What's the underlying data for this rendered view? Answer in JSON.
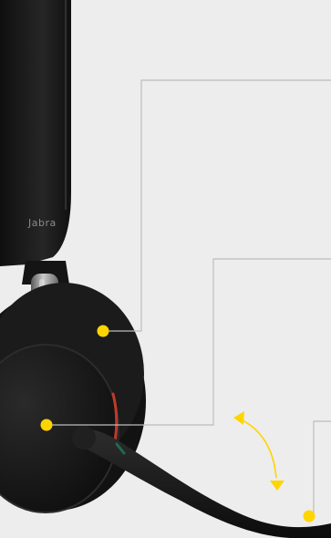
{
  "product": {
    "brand_mark": "Jabra"
  },
  "colors": {
    "background": "#ededed",
    "headset_body": "#161616",
    "metal_slider": "#8d8d8d",
    "callout_line": "#bdbdbd",
    "callout_dot": "#ffd500",
    "boom_arrow": "#ffd500",
    "led_accent": "#c0392b"
  },
  "callouts": [
    {
      "name": "headband-slider-callout"
    },
    {
      "name": "earcup-callout"
    },
    {
      "name": "microphone-callout"
    }
  ],
  "icons": {
    "rotation": "curved-double-arrow-icon",
    "callout_marker": "dot-icon"
  }
}
